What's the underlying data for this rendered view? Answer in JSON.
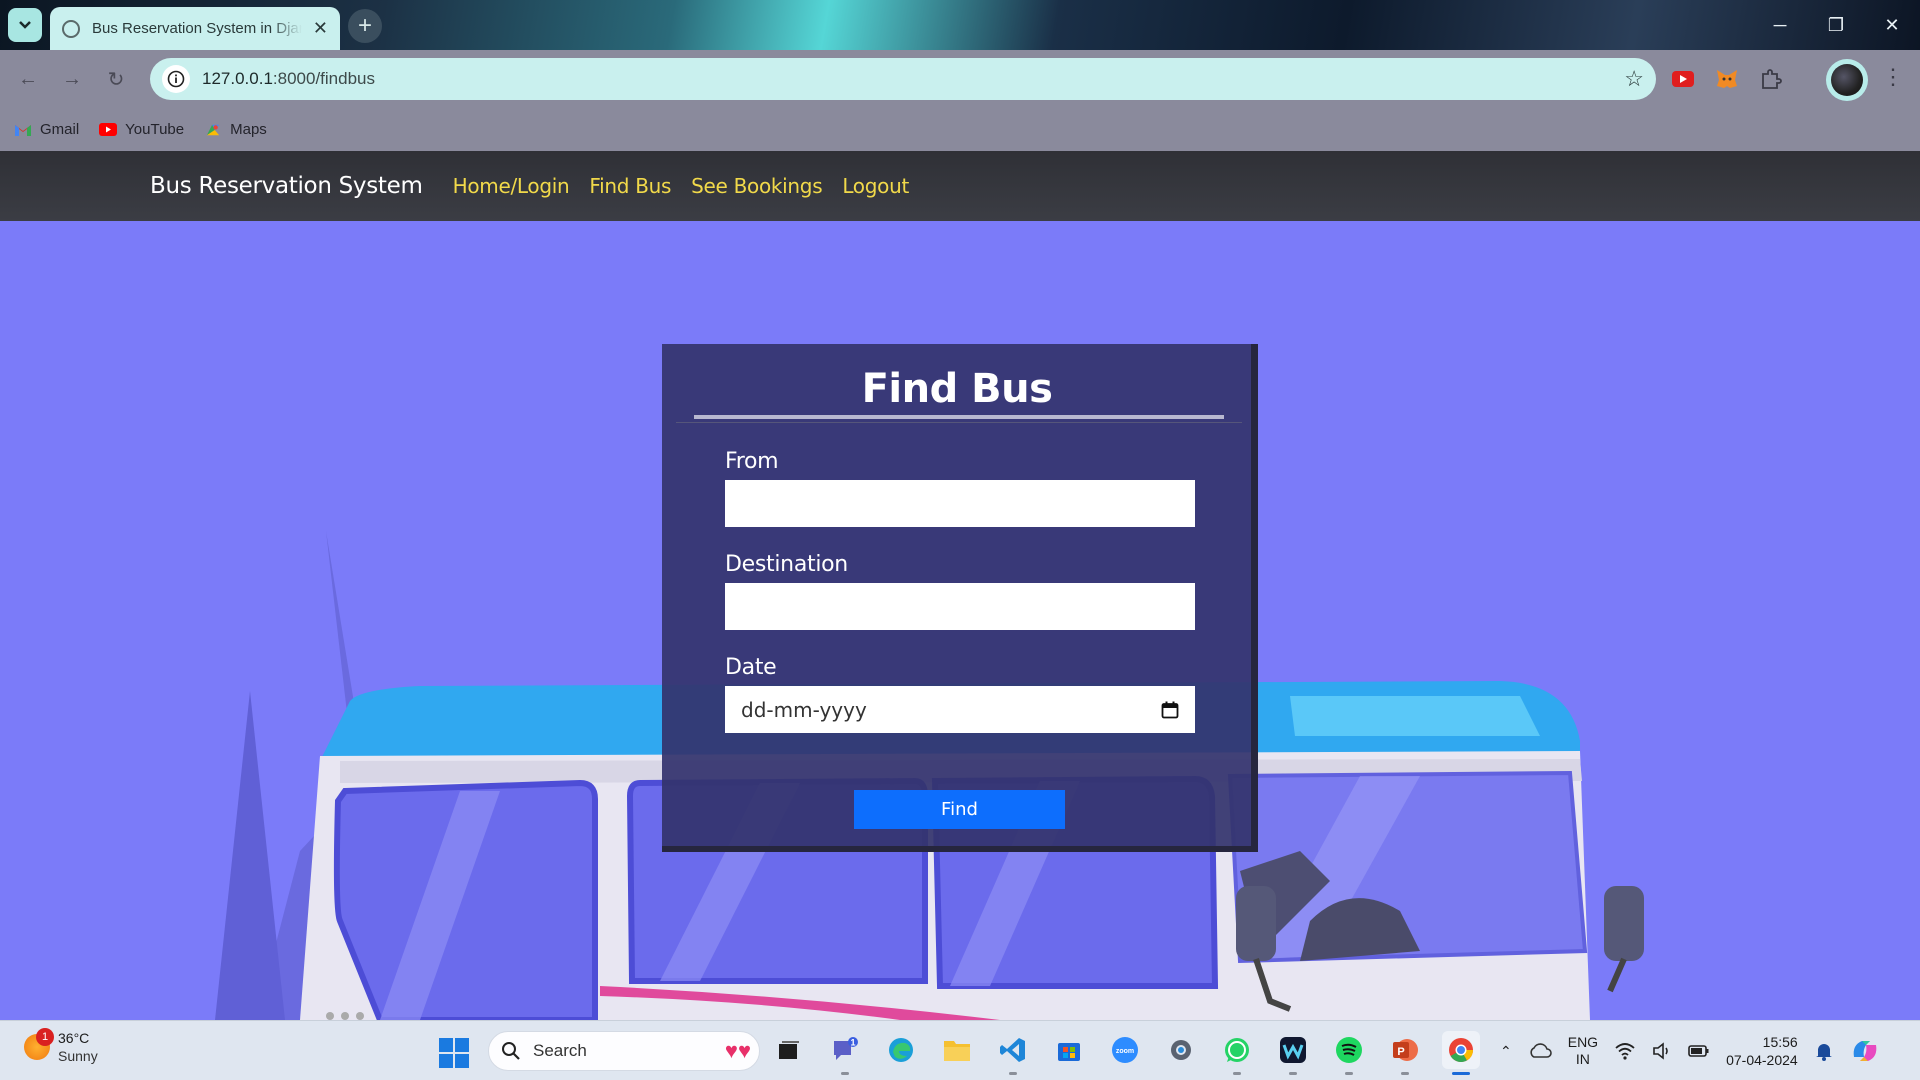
{
  "browser": {
    "tab_title": "Bus Reservation System in Djan",
    "url_host": "127.0.0.1",
    "url_path": ":8000/findbus",
    "bookmarks": [
      {
        "label": "Gmail",
        "icon": "gmail-icon"
      },
      {
        "label": "YouTube",
        "icon": "youtube-icon"
      },
      {
        "label": "Maps",
        "icon": "maps-icon"
      }
    ]
  },
  "navbar": {
    "brand": "Bus Reservation System",
    "links": [
      "Home/Login",
      "Find Bus",
      "See Bookings",
      "Logout"
    ],
    "link_color": "#f1d94a"
  },
  "form": {
    "title": "Find Bus",
    "from_label": "From",
    "from_value": "",
    "destination_label": "Destination",
    "destination_value": "",
    "date_label": "Date",
    "date_placeholder": "dd-mm-yyyy",
    "submit_label": "Find"
  },
  "taskbar": {
    "weather_temp": "36°C",
    "weather_condition": "Sunny",
    "weather_badge": "1",
    "search_placeholder": "Search",
    "chat_badge": "1",
    "lang_top": "ENG",
    "lang_bottom": "IN",
    "time": "15:56",
    "date": "07-04-2024"
  },
  "colors": {
    "page_background": "#7b7bf9",
    "card_background": "#34346e",
    "button_primary": "#0d6efd"
  }
}
